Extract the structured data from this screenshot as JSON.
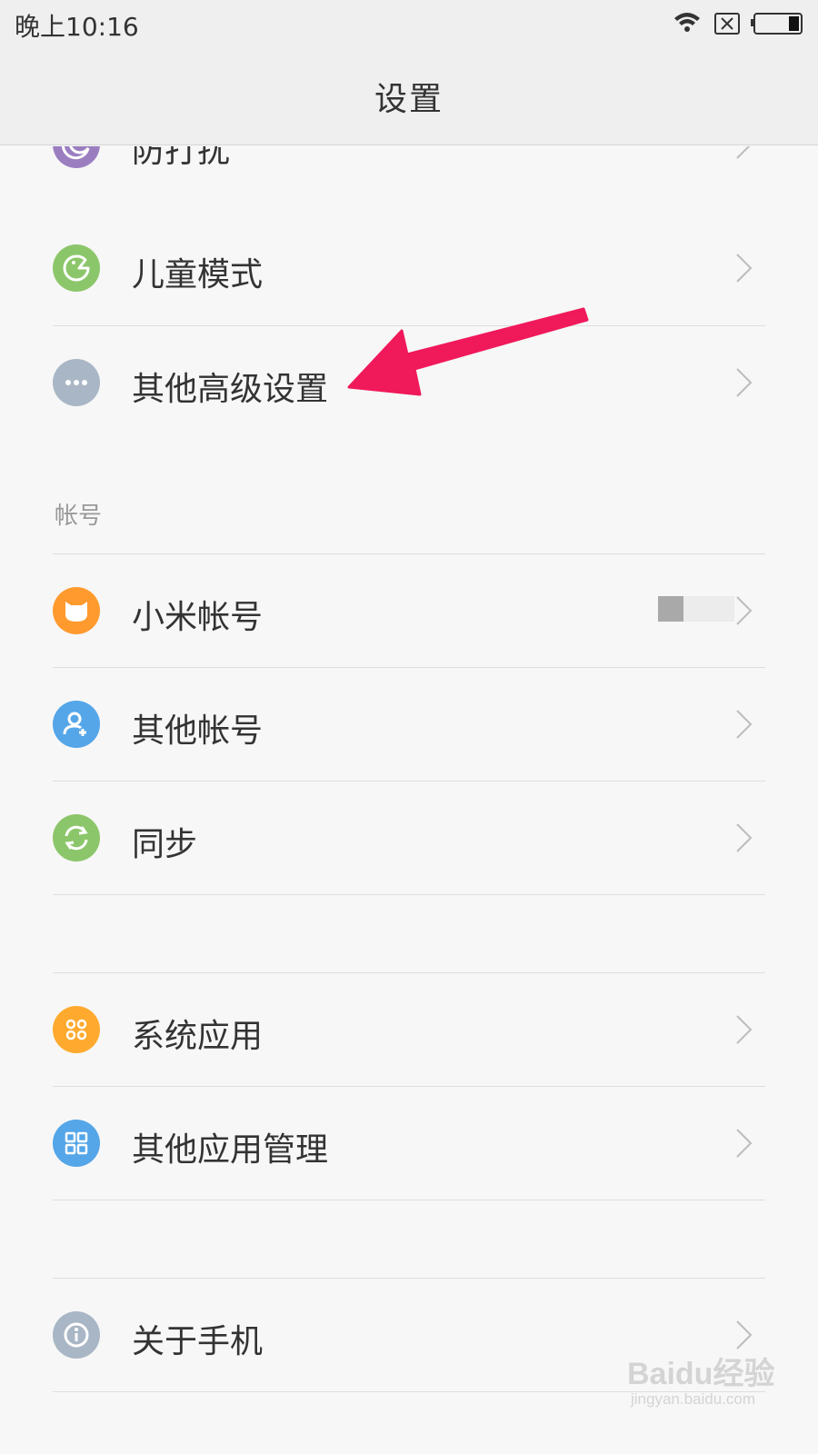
{
  "status_bar": {
    "time": "晚上10:16"
  },
  "header": {
    "title": "设置"
  },
  "settings": {
    "items": [
      {
        "label": "防打扰",
        "icon": "moon-icon",
        "color": "#9b7ec0"
      },
      {
        "label": "儿童模式",
        "icon": "kid-mode-icon",
        "color": "#8cc66a"
      },
      {
        "label": "其他高级设置",
        "icon": "more-dots-icon",
        "color": "#a9b6c5"
      }
    ]
  },
  "accounts": {
    "header": "帐号",
    "items": [
      {
        "label": "小米帐号",
        "icon": "mi-bunny-icon",
        "color": "#ff9a2e"
      },
      {
        "label": "其他帐号",
        "icon": "add-user-icon",
        "color": "#54a6e8"
      },
      {
        "label": "同步",
        "icon": "sync-icon",
        "color": "#8cc66a"
      }
    ]
  },
  "apps": {
    "items": [
      {
        "label": "系统应用",
        "icon": "system-apps-icon",
        "color": "#ffaa2e"
      },
      {
        "label": "其他应用管理",
        "icon": "app-grid-icon",
        "color": "#54a6e8"
      }
    ]
  },
  "about": {
    "items": [
      {
        "label": "关于手机",
        "icon": "info-icon",
        "color": "#a9b6c5"
      }
    ]
  },
  "annotation": {
    "arrow_color": "#f0195a"
  },
  "watermark": {
    "text": "Baidu经验",
    "sub": "jingyan.baidu.com"
  }
}
